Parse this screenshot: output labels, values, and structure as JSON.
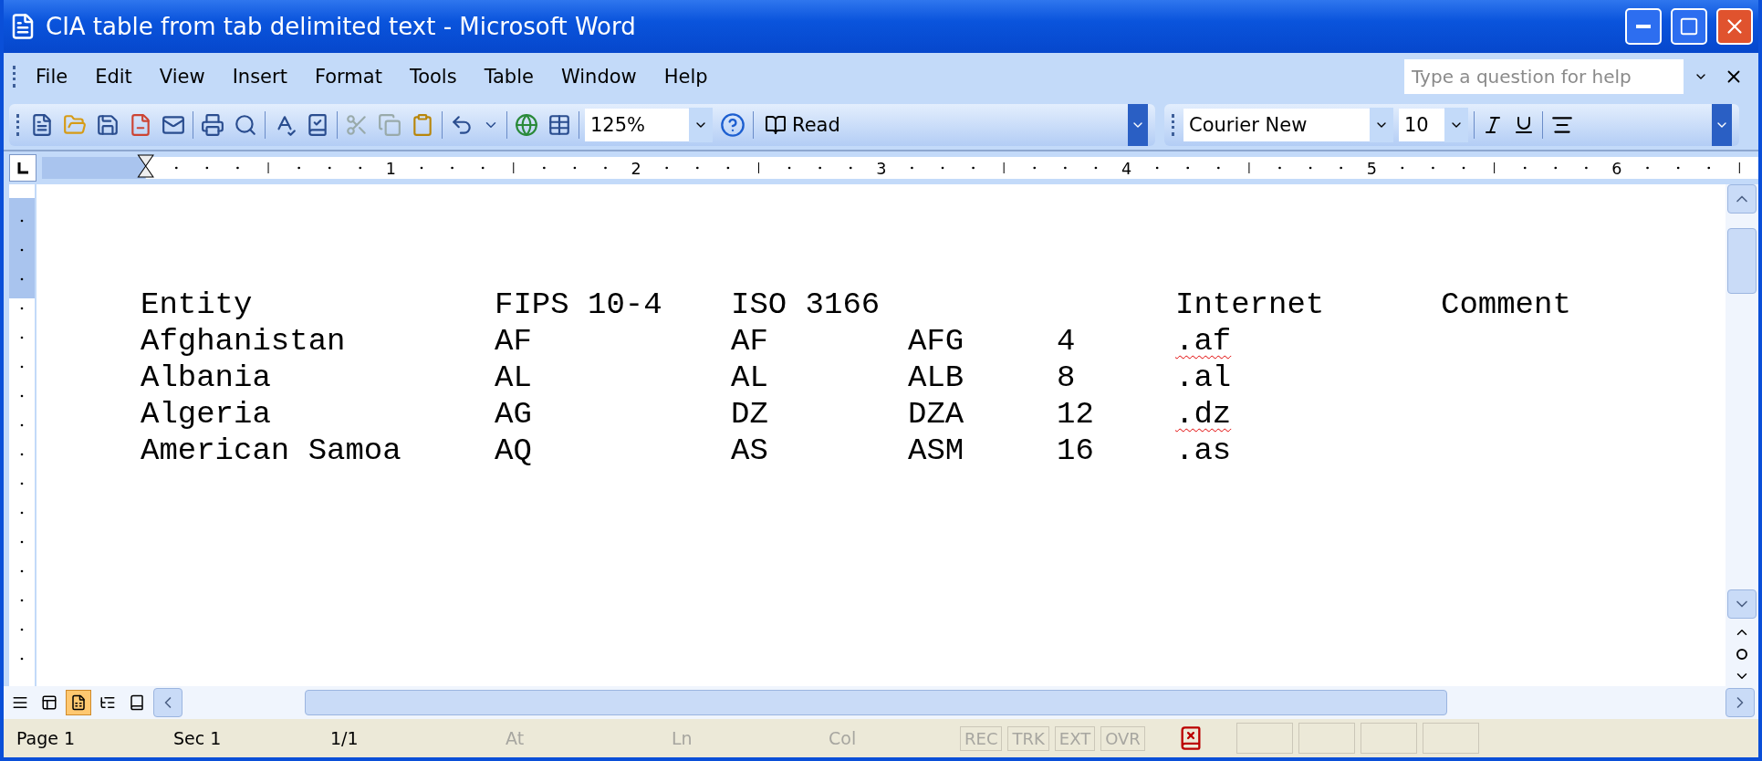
{
  "window": {
    "title": "CIA table from tab delimited text - Microsoft Word"
  },
  "menu": [
    "File",
    "Edit",
    "View",
    "Insert",
    "Format",
    "Tools",
    "Table",
    "Window",
    "Help"
  ],
  "help_field": {
    "placeholder": "Type a question for help"
  },
  "toolbar": {
    "zoom": "125%",
    "read": "Read",
    "font": "Courier New",
    "size": "10"
  },
  "ruler": {
    "labels": [
      "1",
      "2",
      "3",
      "4",
      "5",
      "6"
    ]
  },
  "document": {
    "header": [
      "Entity",
      "FIPS 10-4",
      "ISO 3166",
      "Internet",
      "Comment"
    ],
    "rows": [
      {
        "cells": [
          "Afghanistan",
          "AF",
          "AF",
          "AFG",
          "4"
        ],
        "internet": ".af",
        "misspelled": true
      },
      {
        "cells": [
          "Albania",
          "AL",
          "AL",
          "ALB",
          "8"
        ],
        "internet": ".al",
        "misspelled": false
      },
      {
        "cells": [
          "Algeria",
          "AG",
          "DZ",
          "DZA",
          "12"
        ],
        "internet": ".dz",
        "misspelled": true
      },
      {
        "cells": [
          "American Samoa",
          "AQ",
          "AS",
          "ASM",
          "16"
        ],
        "internet": ".as",
        "misspelled": false
      }
    ]
  },
  "view_buttons": [
    {
      "kind": "normal",
      "selected": false
    },
    {
      "kind": "web",
      "selected": false
    },
    {
      "kind": "print",
      "selected": true
    },
    {
      "kind": "outline",
      "selected": false
    },
    {
      "kind": "reading",
      "selected": false
    }
  ],
  "status_bar": {
    "items": [
      {
        "text": "Page 1",
        "disabled": false
      },
      {
        "text": "Sec 1",
        "disabled": false
      },
      {
        "text": "1/1",
        "disabled": false
      },
      {
        "text": "At",
        "disabled": true
      },
      {
        "text": "Ln",
        "disabled": true
      },
      {
        "text": "Col",
        "disabled": true
      }
    ],
    "modes": [
      {
        "text": "REC",
        "disabled": true
      },
      {
        "text": "TRK",
        "disabled": true
      },
      {
        "text": "EXT",
        "disabled": true
      },
      {
        "text": "OVR",
        "disabled": true
      }
    ]
  }
}
